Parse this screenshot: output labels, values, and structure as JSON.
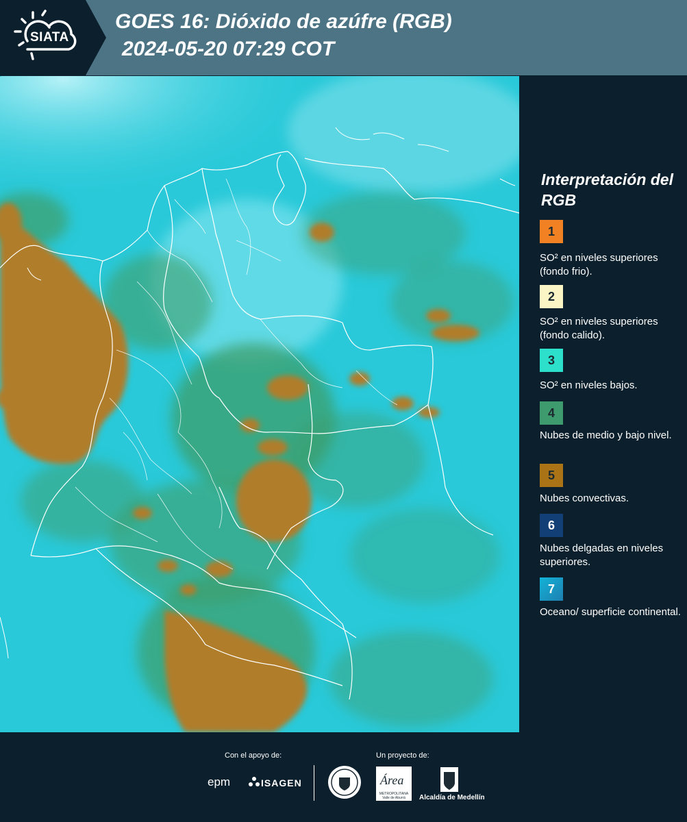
{
  "header": {
    "logo_text": "SIATA",
    "title": "GOES 16: Dióxido de azúfre (RGB)",
    "subtitle": "2024-05-20 07:29 COT",
    "logo_icon": "sun-cloud-icon"
  },
  "legend": {
    "title": "Interpretación del RGB",
    "items": [
      {
        "number": "1",
        "label": "SO² en niveles superiores (fondo frio).",
        "color": "#f28123"
      },
      {
        "number": "2",
        "label": "SO² en niveles superiores (fondo calido).",
        "color": "#fbf4c4"
      },
      {
        "number": "3",
        "label": "SO² en niveles bajos.",
        "color": "#2de0cc"
      },
      {
        "number": "4",
        "label": "Nubes de medio y bajo nivel.",
        "color": "#3d9b6e"
      },
      {
        "number": "5",
        "label": "Nubes convectivas.",
        "color": "#a97316"
      },
      {
        "number": "6",
        "label": "Nubes delgadas en niveles superiores.",
        "color": "#123f75"
      },
      {
        "number": "7",
        "label": "Oceano/ superficie continental.",
        "color": "#1e9ec9"
      }
    ]
  },
  "map": {
    "colors": {
      "background": "#29c9d9",
      "haze": "#8ee8f2",
      "low_cloud": "#3f9e6a",
      "convective": "#b07d2c",
      "border": "#ffffff"
    }
  },
  "footer": {
    "support_label": "Con el apoyo de:",
    "project_label": "Un proyecto de:",
    "sponsor_1": "epm",
    "sponsor_2": "ISAGEN",
    "area_logo_text": "Área",
    "area_sub": "METROPOLITANA Valle de Aburrá",
    "alcaldia_label": "Alcaldía de Medellín"
  }
}
